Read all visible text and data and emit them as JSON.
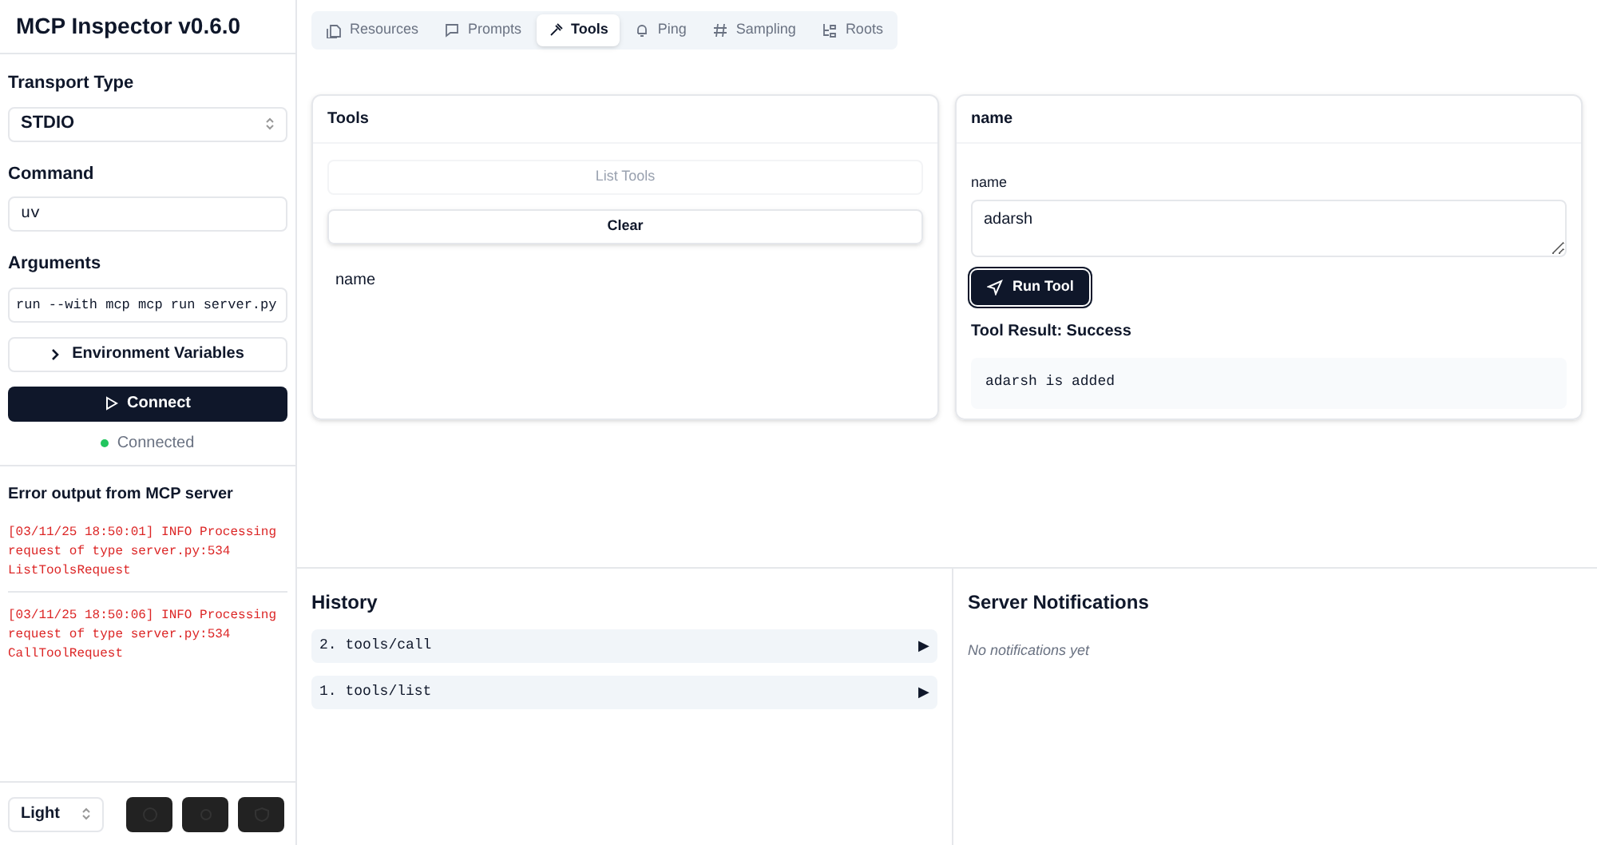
{
  "sidebar": {
    "title": "MCP Inspector v0.6.0",
    "transport": {
      "label": "Transport Type",
      "value": "STDIO"
    },
    "command": {
      "label": "Command",
      "value": "uv"
    },
    "arguments": {
      "label": "Arguments",
      "value": "run --with mcp mcp run server.py"
    },
    "env_button": "Environment Variables",
    "connect_button": "Connect",
    "status": {
      "label": "Connected",
      "connected": true
    },
    "error_title": "Error output from MCP server",
    "errors": [
      "[03/11/25 18:50:01] INFO Processing request of type server.py:534 ListToolsRequest",
      "[03/11/25 18:50:06] INFO Processing request of type server.py:534 CallToolRequest"
    ],
    "theme": "Light"
  },
  "tabs": [
    {
      "label": "Resources",
      "selected": false
    },
    {
      "label": "Prompts",
      "selected": false
    },
    {
      "label": "Tools",
      "selected": true
    },
    {
      "label": "Ping",
      "selected": false
    },
    {
      "label": "Sampling",
      "selected": false
    },
    {
      "label": "Roots",
      "selected": false
    }
  ],
  "tools_panel": {
    "title": "Tools",
    "list_button": {
      "label": "List Tools",
      "disabled": true
    },
    "clear_button": "Clear",
    "tools": [
      "name"
    ]
  },
  "tool_panel": {
    "title": "name",
    "field_label": "name",
    "field_value": "adarsh",
    "run_button": "Run Tool",
    "result_title": "Tool Result: Success",
    "result": "adarsh is added"
  },
  "history": {
    "title": "History",
    "items": [
      {
        "label": "2. tools/call",
        "toggle": "▶"
      },
      {
        "label": "1. tools/list",
        "toggle": "▶"
      }
    ]
  },
  "notifications": {
    "title": "Server Notifications",
    "empty": "No notifications yet"
  }
}
